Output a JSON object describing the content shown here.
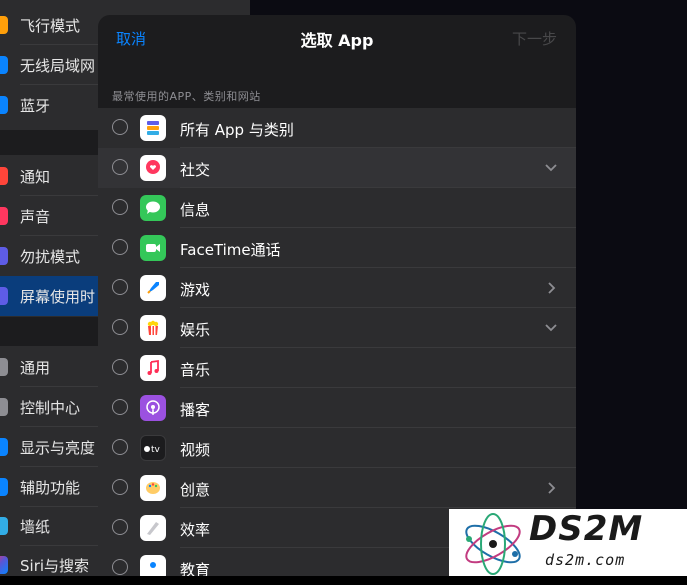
{
  "settings": {
    "items": [
      {
        "label": "飞行模式",
        "icon": "airplane-icon",
        "color": "#ff9f0a"
      },
      {
        "label": "无线局域网",
        "icon": "wifi-icon",
        "color": "#0a84ff"
      },
      {
        "label": "蓝牙",
        "icon": "bluetooth-icon",
        "color": "#0a84ff"
      },
      {
        "label": "通知",
        "icon": "notifications-icon",
        "color": "#ff453a"
      },
      {
        "label": "声音",
        "icon": "sound-icon",
        "color": "#ff375f"
      },
      {
        "label": "勿扰模式",
        "icon": "moon-icon",
        "color": "#5e5ce6"
      },
      {
        "label": "屏幕使用时",
        "icon": "hourglass-icon",
        "color": "#5e5ce6"
      },
      {
        "label": "通用",
        "icon": "gear-icon",
        "color": "#8e8e93"
      },
      {
        "label": "控制中心",
        "icon": "control-center-icon",
        "color": "#8e8e93"
      },
      {
        "label": "显示与亮度",
        "icon": "display-icon",
        "color": "#0a84ff"
      },
      {
        "label": "辅助功能",
        "icon": "accessibility-icon",
        "color": "#0a84ff"
      },
      {
        "label": "墙纸",
        "icon": "wallpaper-icon",
        "color": "#32ade6"
      },
      {
        "label": "Siri与搜索",
        "icon": "siri-icon",
        "color": "#1c1c1e"
      }
    ]
  },
  "modal": {
    "cancel_label": "取消",
    "title": "选取 App",
    "next_label": "下一步",
    "section_header": "最常使用的APP、类别和网站",
    "rows": [
      {
        "label": "所有 App 与类别",
        "icon": "stack-icon",
        "chevron": "none"
      },
      {
        "label": "社交",
        "icon": "social-icon",
        "chevron": "down"
      },
      {
        "label": "信息",
        "icon": "messages-icon",
        "chevron": "none"
      },
      {
        "label": "FaceTime通话",
        "icon": "facetime-icon",
        "chevron": "none"
      },
      {
        "label": "游戏",
        "icon": "games-icon",
        "chevron": "right"
      },
      {
        "label": "娱乐",
        "icon": "entertainment-icon",
        "chevron": "down"
      },
      {
        "label": "音乐",
        "icon": "music-icon",
        "chevron": "none"
      },
      {
        "label": "播客",
        "icon": "podcasts-icon",
        "chevron": "none"
      },
      {
        "label": "视频",
        "icon": "apple-tv-icon",
        "chevron": "none"
      },
      {
        "label": "创意",
        "icon": "creativity-icon",
        "chevron": "right"
      },
      {
        "label": "效率",
        "icon": "productivity-icon",
        "chevron": "none"
      },
      {
        "label": "教育",
        "icon": "education-icon",
        "chevron": "none"
      }
    ]
  },
  "watermark": {
    "title": "DS2M",
    "subtitle": "ds2m.com"
  },
  "colors": {
    "accent": "#0a84ff",
    "selected_row": "#0a3d7c"
  }
}
